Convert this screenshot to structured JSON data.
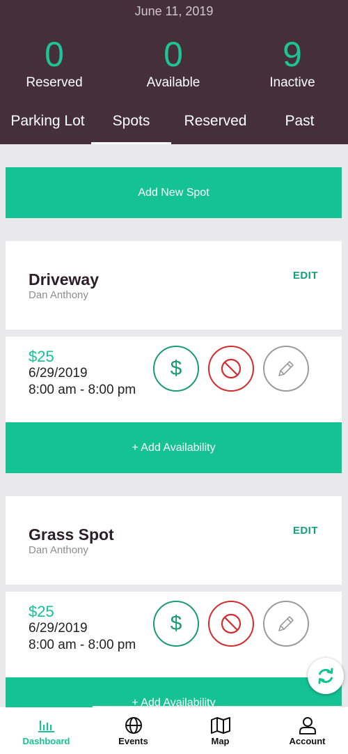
{
  "header": {
    "date": "June 11, 2019",
    "stats": [
      {
        "value": "0",
        "label": "Reserved"
      },
      {
        "value": "0",
        "label": "Available"
      },
      {
        "value": "9",
        "label": "Inactive"
      }
    ],
    "tabs": [
      "Parking Lot",
      "Spots",
      "Reserved",
      "Past"
    ],
    "active_tab": "Spots"
  },
  "add_new_spot": "Add New Spot",
  "spots": [
    {
      "title": "Driveway",
      "owner": "Dan Anthony",
      "edit": "EDIT",
      "availability": {
        "price": "$25",
        "date": "6/29/2019",
        "time": "8:00 am - 8:00 pm"
      },
      "add_availability": "+ Add Availability"
    },
    {
      "title": "Grass Spot",
      "owner": "Dan Anthony",
      "edit": "EDIT",
      "availability": {
        "price": "$25",
        "date": "6/29/2019",
        "time": "8:00 am - 8:00 pm"
      },
      "add_availability": "+ Add Availability"
    }
  ],
  "bottom_nav": [
    {
      "label": "Dashboard",
      "icon": "bar-chart-icon"
    },
    {
      "label": "Events",
      "icon": "globe-icon"
    },
    {
      "label": "Map",
      "icon": "map-icon"
    },
    {
      "label": "Account",
      "icon": "user-icon"
    }
  ],
  "colors": {
    "accent": "#14c294",
    "header": "#45303a",
    "danger": "#d52b2b"
  }
}
